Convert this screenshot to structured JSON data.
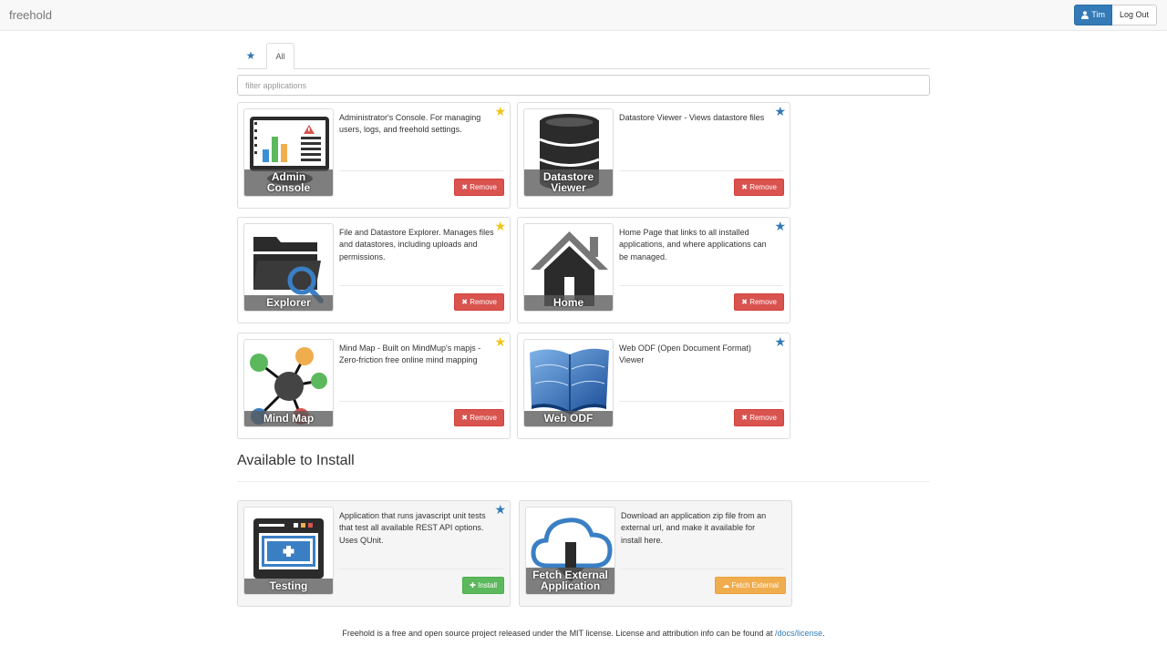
{
  "navbar": {
    "brand": "freehold",
    "user_label": "Tim",
    "logout_label": "Log Out",
    "user_icon": "user-icon"
  },
  "tabs": {
    "favorites_icon": "star-icon",
    "all_label": "All"
  },
  "filter": {
    "placeholder": "filter applications",
    "value": ""
  },
  "installed": [
    {
      "name": "Admin Console",
      "label_line1": "Admin",
      "label_line2": "Console",
      "description": "Administrator's Console. For managing users, logs, and freehold settings.",
      "favorite": true,
      "button": "Remove"
    },
    {
      "name": "Datastore Viewer",
      "label_line1": "Datastore",
      "label_line2": "Viewer",
      "description": "Datastore Viewer - Views datastore files",
      "favorite": false,
      "button": "Remove"
    },
    {
      "name": "Explorer",
      "label_line1": "Explorer",
      "label_line2": "",
      "description": "File and Datastore Explorer. Manages files and datastores, including uploads and permissions.",
      "favorite": true,
      "button": "Remove"
    },
    {
      "name": "Home",
      "label_line1": "Home",
      "label_line2": "",
      "description": "Home Page that links to all installed applications, and where applications can be managed.",
      "favorite": false,
      "button": "Remove"
    },
    {
      "name": "Mind Map",
      "label_line1": "Mind Map",
      "label_line2": "",
      "description": "Mind Map - Built on MindMup's mapjs - Zero-friction free online mind mapping",
      "favorite": true,
      "button": "Remove"
    },
    {
      "name": "Web ODF",
      "label_line1": "Web ODF",
      "label_line2": "",
      "description": "Web ODF (Open Document Format) Viewer",
      "favorite": false,
      "button": "Remove"
    }
  ],
  "available": {
    "title": "Available to Install",
    "apps": [
      {
        "name": "Testing",
        "label_line1": "Testing",
        "label_line2": "",
        "description": "Application that runs javascript unit tests that test all available REST API options. Uses QUnit.",
        "favorite": false,
        "button": "Install"
      },
      {
        "name": "Fetch External Application",
        "label_line1": "Fetch External",
        "label_line2": "Application",
        "description": "Download an application zip file from an external url, and make it available for install here.",
        "button": "Fetch External"
      }
    ]
  },
  "footer": {
    "text": "Freehold is a free and open source project released under the MIT license. License and attribution info can be found at ",
    "link_text": "/docs/license",
    "trailing": "."
  },
  "colors": {
    "primary": "#337ab7",
    "danger": "#d9534f",
    "success": "#5cb85c",
    "warning": "#f0ad4e",
    "favorite_star": "#f0c419"
  }
}
